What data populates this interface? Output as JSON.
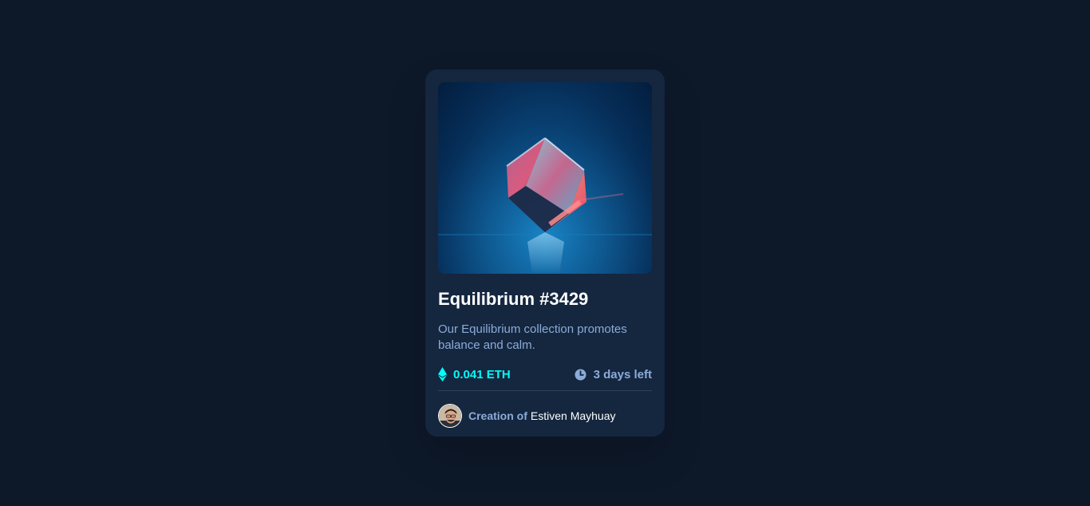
{
  "card": {
    "title": "Equilibrium #3429",
    "description": "Our Equilibrium collection promotes balance and calm.",
    "price": "0.041 ETH",
    "time_left": "3 days left",
    "creator_prefix": "Creation of",
    "creator_name": "Estiven Mayhuay"
  },
  "icons": {
    "price": "ethereum-icon",
    "time": "clock-icon"
  },
  "colors": {
    "page_background": "#0d1829",
    "card_background": "#15263f",
    "accent_cyan": "#00fff8",
    "soft_blue": "#8bacd9",
    "white": "#ffffff",
    "divider": "#2e405a"
  }
}
